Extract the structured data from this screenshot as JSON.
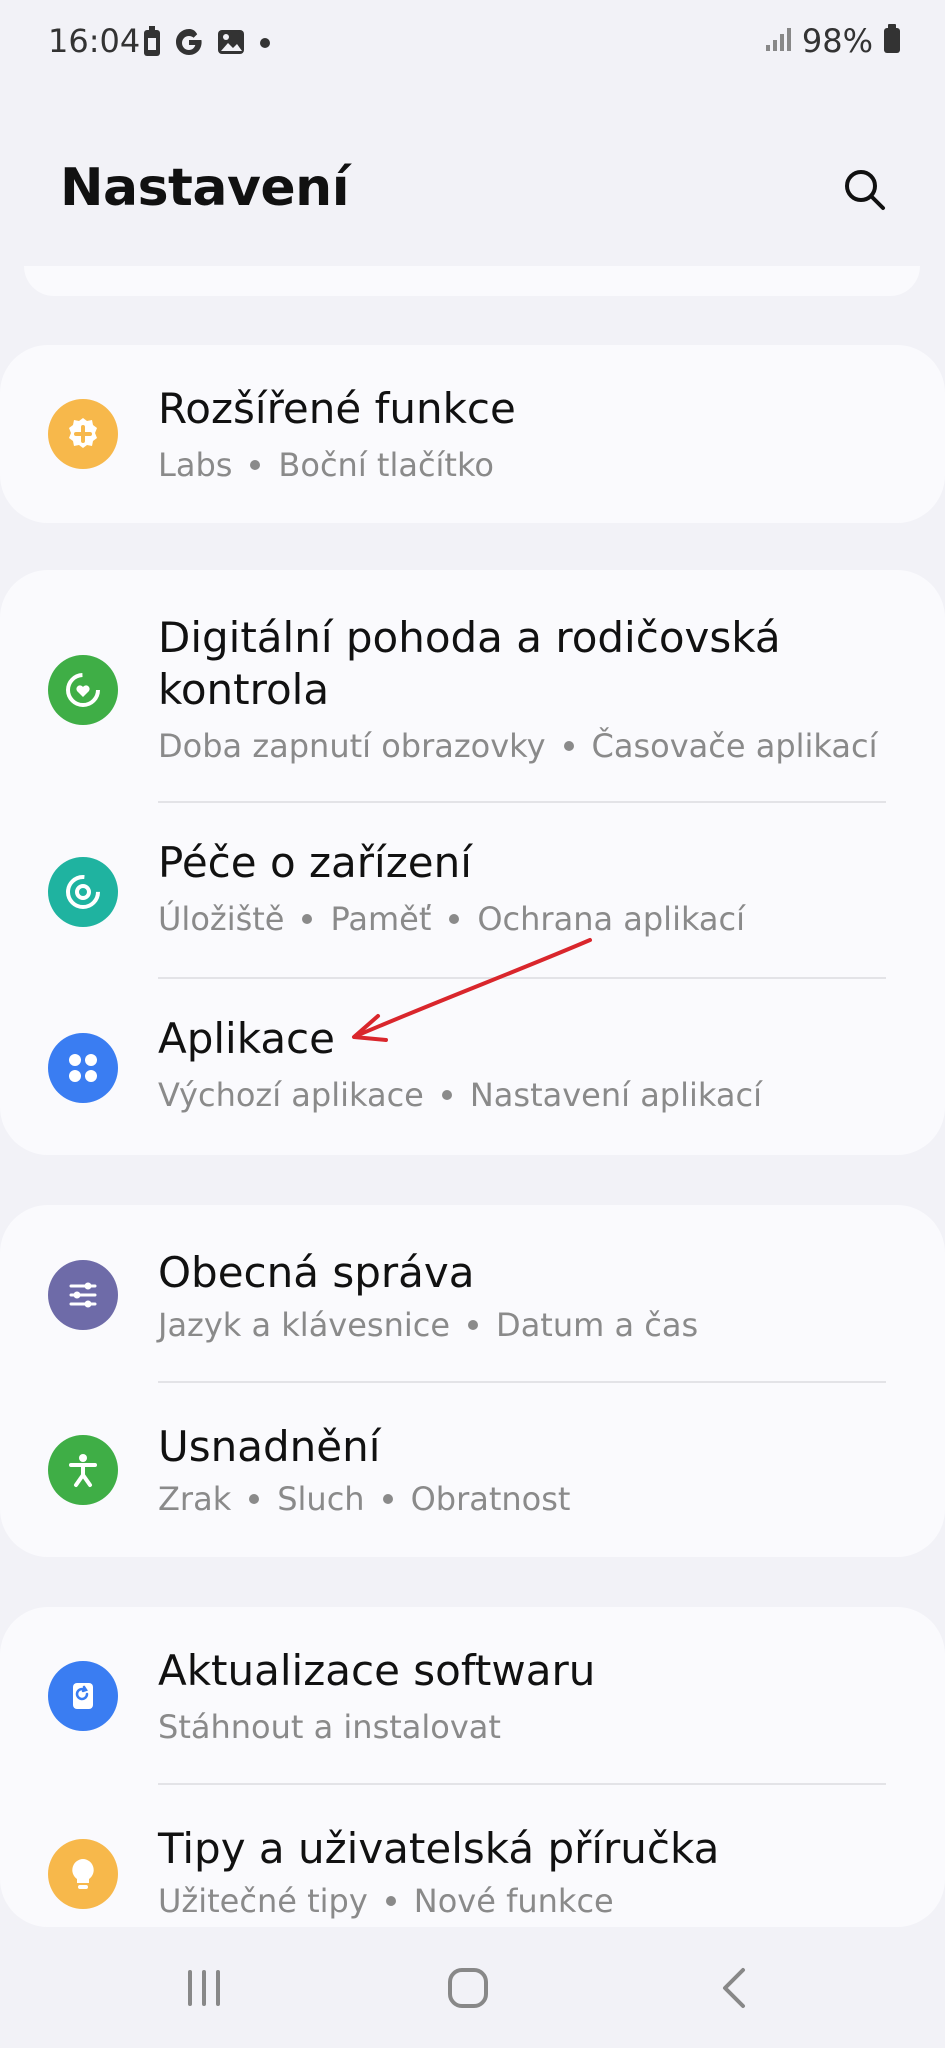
{
  "status": {
    "time": "16:04",
    "battery": "98%"
  },
  "header": {
    "title": "Nastavení"
  },
  "cards": [
    {
      "items": [
        {
          "title": "Rozšířené funkce",
          "subs": [
            "Labs",
            "Boční tlačítko"
          ],
          "icon": "gear-plus-icon",
          "color": "#f7b84b"
        }
      ]
    },
    {
      "items": [
        {
          "title1": "Digitální pohoda a rodičovská",
          "title2": "kontrola",
          "subs": [
            "Doba zapnutí obrazovky",
            "Časovače aplikací"
          ],
          "icon": "wellbeing-icon",
          "color": "#3fae46"
        },
        {
          "title": "Péče o zařízení",
          "subs": [
            "Úložiště",
            "Paměť",
            "Ochrana aplikací"
          ],
          "icon": "device-care-icon",
          "color": "#1fb3a0"
        },
        {
          "title": "Aplikace",
          "subs": [
            "Výchozí aplikace",
            "Nastavení aplikací"
          ],
          "icon": "apps-grid-icon",
          "color": "#3a7df2"
        }
      ]
    },
    {
      "items": [
        {
          "title": "Obecná správa",
          "subs": [
            "Jazyk a klávesnice",
            "Datum a čas"
          ],
          "icon": "sliders-icon",
          "color": "#6e6ba8"
        },
        {
          "title": "Usnadnění",
          "subs": [
            "Zrak",
            "Sluch",
            "Obratnost"
          ],
          "icon": "accessibility-icon",
          "color": "#3fae46"
        }
      ]
    },
    {
      "items": [
        {
          "title": "Aktualizace softwaru",
          "subs": [
            "Stáhnout a instalovat"
          ],
          "icon": "software-update-icon",
          "color": "#3a7df2"
        },
        {
          "title": "Tipy a uživatelská příručka",
          "subs": [
            "Užitečné tipy",
            "Nové funkce"
          ],
          "icon": "lightbulb-icon",
          "color": "#f7b84b"
        }
      ]
    }
  ],
  "annotation": {
    "color": "#d9262c"
  }
}
